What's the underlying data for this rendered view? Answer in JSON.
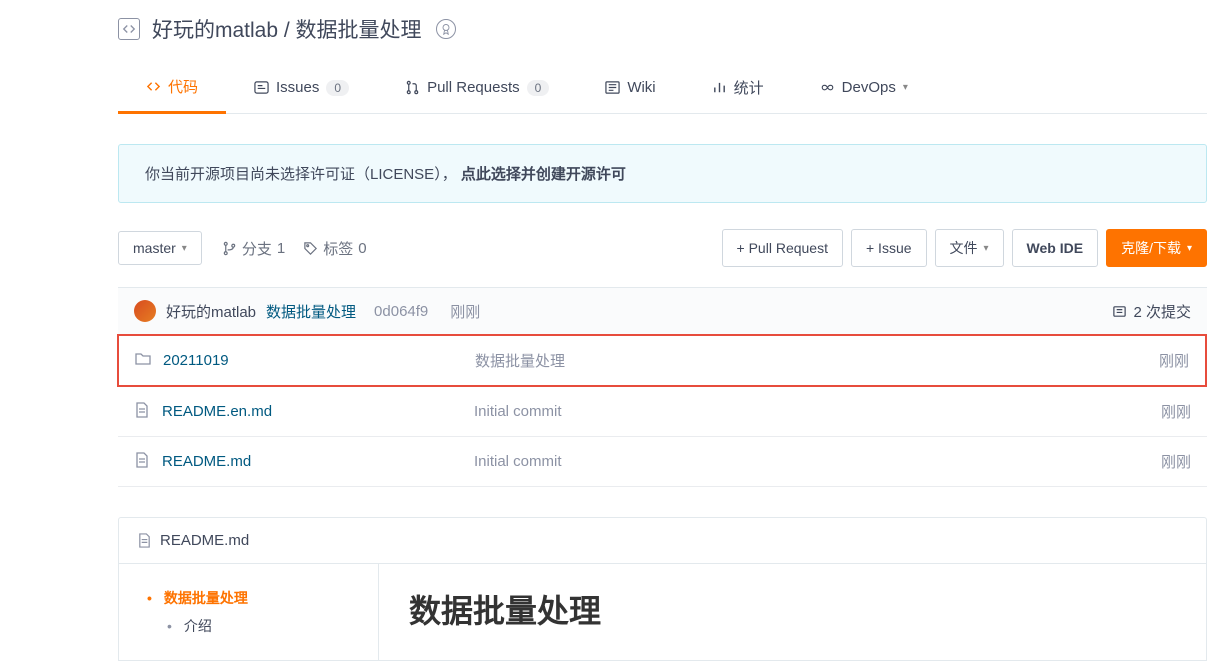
{
  "header": {
    "owner": "好玩的matlab",
    "repo": "数据批量处理"
  },
  "tabs": {
    "code": "代码",
    "issues": "Issues",
    "issues_count": "0",
    "pr": "Pull Requests",
    "pr_count": "0",
    "wiki": "Wiki",
    "stats": "统计",
    "devops": "DevOps"
  },
  "notice": {
    "text": "你当前开源项目尚未选择许可证（LICENSE）， ",
    "action": "点此选择并创建开源许可"
  },
  "toolbar": {
    "branch": "master",
    "branches_label": "分支",
    "branches_count": "1",
    "tags_label": "标签",
    "tags_count": "0",
    "pull_request": "+ Pull Request",
    "issue": "+ Issue",
    "files": "文件",
    "web_ide": "Web IDE",
    "clone": "克隆/下载"
  },
  "commit": {
    "author": "好玩的matlab",
    "message": "数据批量处理",
    "hash": "0d064f9",
    "time": "刚刚",
    "commits_label": "2 次提交"
  },
  "files": [
    {
      "name": "20211019",
      "msg": "数据批量处理",
      "time": "刚刚",
      "type": "folder"
    },
    {
      "name": "README.en.md",
      "msg": "Initial commit",
      "time": "刚刚",
      "type": "file"
    },
    {
      "name": "README.md",
      "msg": "Initial commit",
      "time": "刚刚",
      "type": "file"
    }
  ],
  "readme": {
    "filename": "README.md",
    "toc": [
      {
        "label": "数据批量处理",
        "active": true
      },
      {
        "label": "介绍",
        "active": false,
        "sub": true
      }
    ],
    "heading": "数据批量处理"
  }
}
